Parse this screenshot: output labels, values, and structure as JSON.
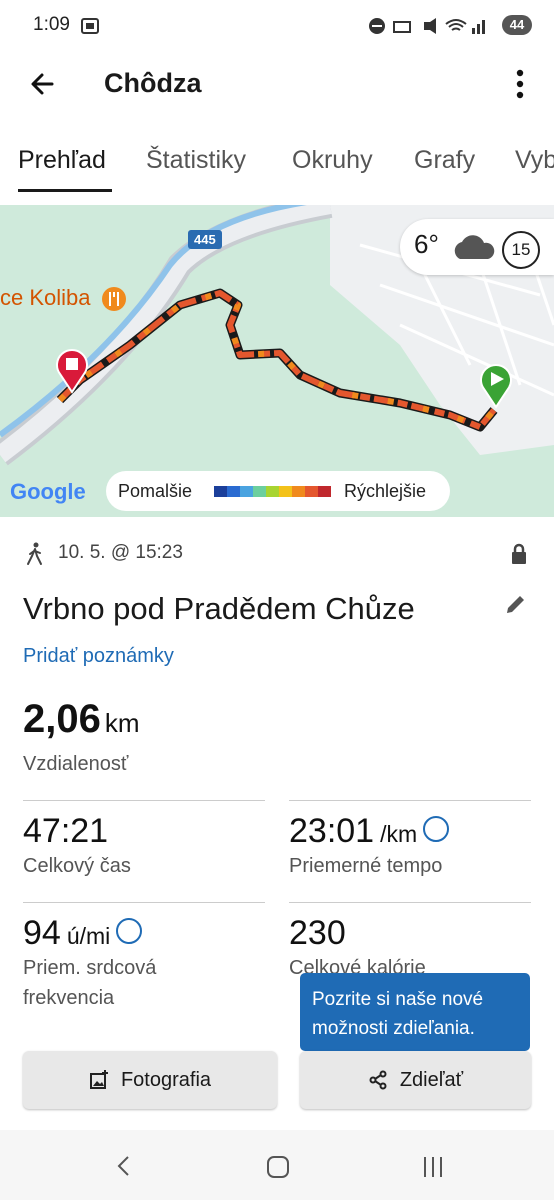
{
  "status_bar": {
    "time": "1:09",
    "battery": "44"
  },
  "app_bar": {
    "title": "Chôdza"
  },
  "tabs": [
    {
      "label": "Prehľad"
    },
    {
      "label": "Štatistiky"
    },
    {
      "label": "Okruhy"
    },
    {
      "label": "Grafy"
    },
    {
      "label": "Vyb"
    }
  ],
  "map": {
    "road_number": "445",
    "poi_label": "ce Koliba",
    "weather_temp": "6°",
    "wind_speed": "15",
    "google_logo": "Google",
    "legend_slow": "Pomalšie",
    "legend_fast": "Rýchlejšie",
    "legend_colors": [
      "#1b3f9a",
      "#2a6bd1",
      "#4aa3e0",
      "#6ccf9e",
      "#a8d431",
      "#f3c21a",
      "#f08a1d",
      "#e4572e",
      "#c0282d"
    ]
  },
  "activity": {
    "datetime": "10. 5. @ 15:23",
    "name": "Vrbno pod Pradědem Chůze",
    "add_note": "Pridať poznámky",
    "distance_value": "2,06",
    "distance_unit": "km",
    "distance_label": "Vzdialenosť"
  },
  "stats": {
    "total_time_value": "47:21",
    "total_time_label": "Celkový čas",
    "avg_pace_value": "23:01",
    "avg_pace_unit": "/km",
    "avg_pace_label": "Priemerné tempo",
    "avg_hr_value": "94",
    "avg_hr_unit": "ú/mi",
    "avg_hr_label_line1": "Priem. srdcová",
    "avg_hr_label_line2": "frekvencia",
    "calories_value": "230",
    "calories_label": "Celkové kalórie"
  },
  "buttons": {
    "photo": "Fotografia",
    "share": "Zdieľať"
  },
  "tooltip": {
    "line1": "Pozrite si naše nové",
    "line2": "možnosti zdieľania."
  }
}
